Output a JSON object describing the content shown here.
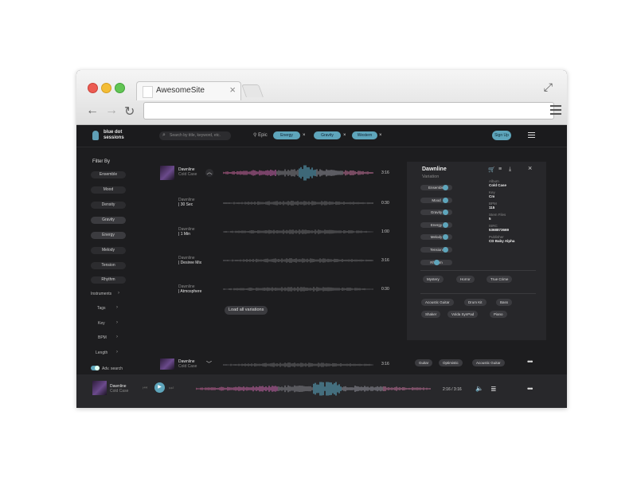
{
  "browser": {
    "tab_title": "AwesomeSite",
    "tab_close": "×"
  },
  "app": {
    "logo_line1": "blue dot",
    "logo_line2": "sessions",
    "search_placeholder": "Search by title, keyword, etc.",
    "active_filters_label": "Epic",
    "active_filters": [
      "Energy",
      "Gravity",
      "Western"
    ],
    "signup_label": "Sign Up",
    "accent": "#5ea5bb"
  },
  "sidebar": {
    "heading": "Filter By",
    "pills": [
      "Ensemble",
      "Mood",
      "Density",
      "Gravity",
      "Energy",
      "Melody",
      "Tension",
      "Rhythm"
    ],
    "sections": [
      "Instruments",
      "Tags",
      "Key",
      "BPM",
      "Length"
    ],
    "adv_search": "Adv. search"
  },
  "tracks": {
    "main": {
      "title": "Dawnline",
      "album": "Cold Case",
      "duration": "3:16"
    },
    "variations": [
      {
        "title": "Dawnline",
        "name": "| 30 Sec",
        "duration": "0:30"
      },
      {
        "title": "Dawnline",
        "name": "| 1 Min",
        "duration": "1:00"
      },
      {
        "title": "Dawnline",
        "name": "| Desiree Mix",
        "duration": "3:16"
      },
      {
        "title": "Dawnline",
        "name": "| Atmosphere",
        "duration": "0:30"
      }
    ],
    "load_all": "Load all variations",
    "second": {
      "title": "Dawnline",
      "album": "Cold Case",
      "duration": "3:16",
      "tags": [
        "Guitar",
        "Optimistic",
        "Acoustic Guitar"
      ]
    }
  },
  "panel": {
    "title": "Dawnline",
    "subtitle": "Variation",
    "attributes": [
      {
        "label": "Ensemble",
        "level": 0.85
      },
      {
        "label": "Mood",
        "level": 0.85
      },
      {
        "label": "Gravity",
        "level": 0.85
      },
      {
        "label": "Energy",
        "level": 0.85
      },
      {
        "label": "Melody",
        "level": 0.85
      },
      {
        "label": "Tension",
        "level": 0.85
      },
      {
        "label": "Rhythm",
        "level": 0.5
      }
    ],
    "meta": [
      {
        "key": "Album",
        "value": "Cold Case"
      },
      {
        "key": "Key",
        "value": "Cm"
      },
      {
        "key": "BPM",
        "value": "115"
      },
      {
        "key": "Stem Files",
        "value": "5"
      },
      {
        "key": "ISRC",
        "value": "5368873669"
      },
      {
        "key": "Publisher",
        "value": "CD Baby Alpha"
      }
    ],
    "moods": [
      "Mystery",
      "Horror",
      "True Crime"
    ],
    "instruments": [
      "Acoustic Guitar",
      "Drum Kit",
      "Bass",
      "Shaker",
      "Volda SynPad",
      "Piano"
    ]
  },
  "player": {
    "title": "Dawnline",
    "album": "Cold Case",
    "time": "2:16 / 3:16",
    "progress": 0.69
  }
}
